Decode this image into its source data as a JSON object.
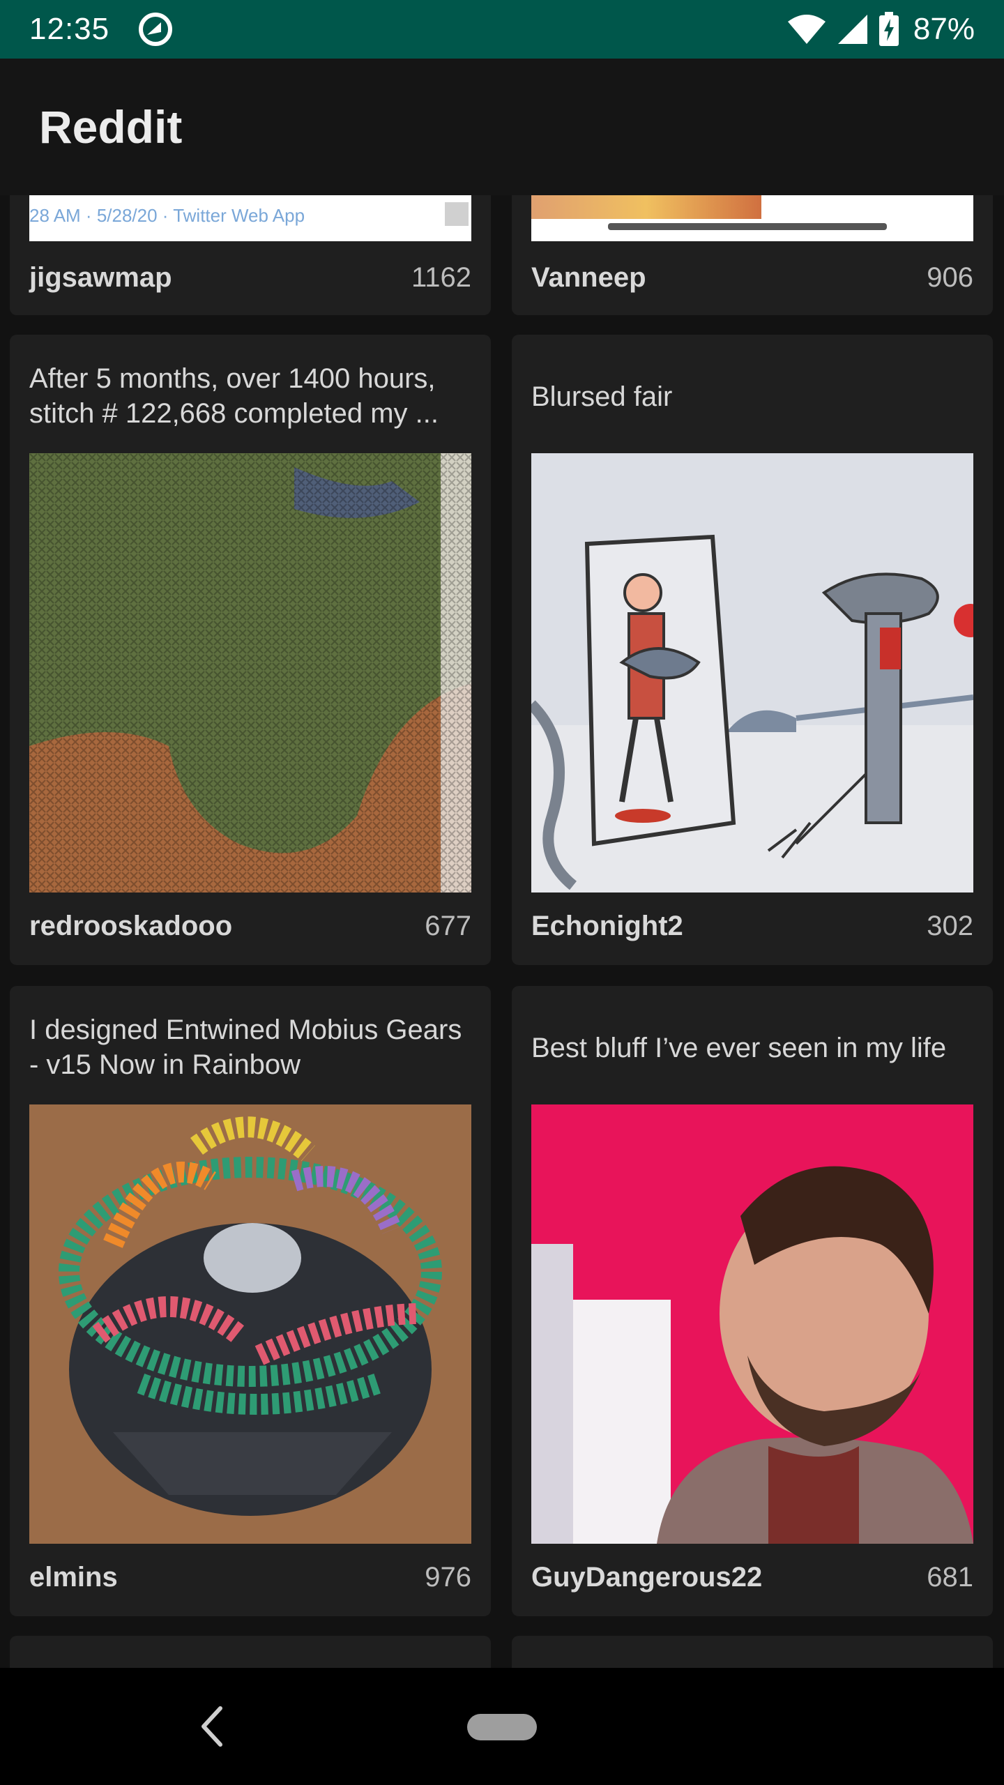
{
  "status_bar": {
    "time": "12:35",
    "battery": "87%",
    "color": "#00574b"
  },
  "app_bar": {
    "title": "Reddit"
  },
  "posts": [
    {
      "title": "",
      "author": "jigsawmap",
      "score": "1162",
      "thumb_caption": "28 AM · 5/28/20 · Twitter Web App"
    },
    {
      "title": "",
      "author": "Vanneep",
      "score": "906"
    },
    {
      "title": "After 5 months, over 1400 hours, stitch # 122,668 completed my ...",
      "author": "redrooskadooo",
      "score": "677"
    },
    {
      "title": "Blursed fair",
      "author": "Echonight2",
      "score": "302"
    },
    {
      "title": "I designed Entwined Mobius Gears - v15 Now in Rainbow",
      "author": "elmins",
      "score": "976"
    },
    {
      "title": "Best bluff I’ve ever seen in my life",
      "author": "GuyDangerous22",
      "score": "681"
    }
  ],
  "icons": {
    "status_app": "data-saver-icon",
    "wifi": "wifi-icon",
    "signal": "cell-signal-icon",
    "battery": "battery-charging-icon",
    "back": "back-chevron-icon",
    "home": "home-pill-icon"
  }
}
